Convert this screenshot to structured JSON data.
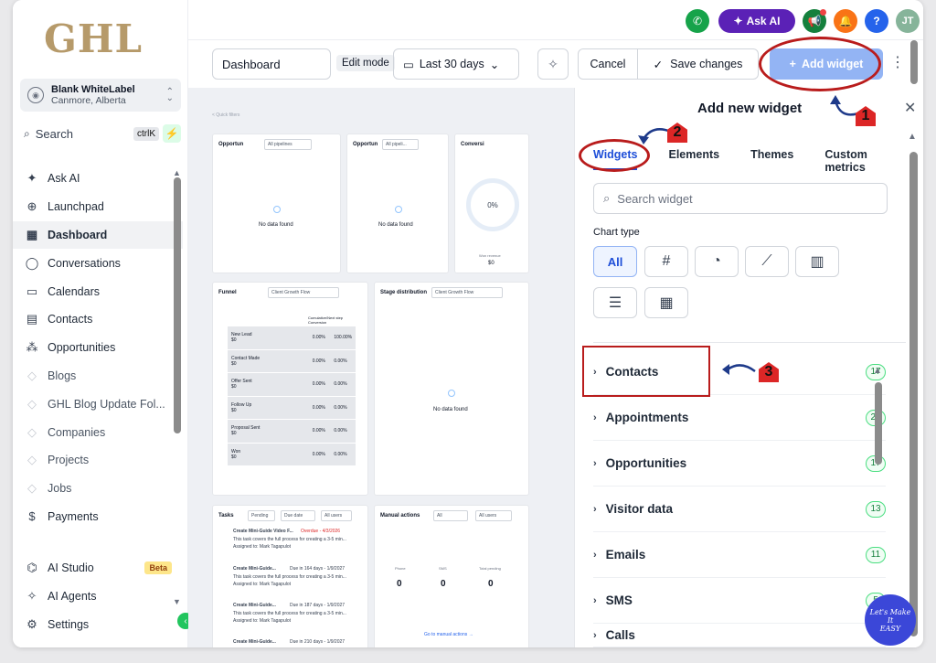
{
  "brand": {
    "logo": "GHL"
  },
  "account": {
    "name": "Blank WhiteLabel",
    "location": "Canmore, Alberta"
  },
  "search": {
    "label": "Search",
    "shortcut": "ctrlK"
  },
  "sidebar": {
    "items": [
      {
        "label": "Ask AI",
        "icon": "sparkle-icon"
      },
      {
        "label": "Launchpad",
        "icon": "rocket-icon"
      },
      {
        "label": "Dashboard",
        "icon": "grid-icon",
        "active": true
      },
      {
        "label": "Conversations",
        "icon": "chat-icon"
      },
      {
        "label": "Calendars",
        "icon": "calendar-icon"
      },
      {
        "label": "Contacts",
        "icon": "contacts-icon"
      },
      {
        "label": "Opportunities",
        "icon": "opportunities-icon"
      },
      {
        "label": "Blogs",
        "icon": "cube-icon",
        "muted": true
      },
      {
        "label": "GHL Blog Update Fol...",
        "icon": "cube-icon",
        "muted": true
      },
      {
        "label": "Companies",
        "icon": "cube-icon",
        "muted": true
      },
      {
        "label": "Projects",
        "icon": "cube-icon",
        "muted": true
      },
      {
        "label": "Jobs",
        "icon": "cube-icon",
        "muted": true
      },
      {
        "label": "Payments",
        "icon": "dollar-icon"
      }
    ],
    "bottom": [
      {
        "label": "AI Studio",
        "badge": "Beta"
      },
      {
        "label": "AI Agents"
      },
      {
        "label": "Settings"
      }
    ]
  },
  "topbar": {
    "ask_ai": "Ask AI",
    "user_initials": "JT",
    "help": "?"
  },
  "toolbar": {
    "dashboard_name": "Dashboard",
    "edit_mode": "Edit mode",
    "date_range": "Last 30 days",
    "cancel": "Cancel",
    "save": "Save changes",
    "add_widget": "Add widget"
  },
  "canvas": {
    "quick_filters": "< Quick filters",
    "cards": {
      "opp1_title": "Opportun",
      "opp1_select": "All pipelines",
      "opp2_title": "Opportun",
      "opp2_select": "All pipeli...",
      "conv_title": "Conversi",
      "no_data": "No data found",
      "ring_value": "0%",
      "won_revenue": "Won revenue",
      "won_value": "$0",
      "funnel_title": "Funnel",
      "funnel_select": "Client Growth Flow",
      "funnel_header": "Cumulative/Next step Conversion",
      "funnel_rows": [
        {
          "stage": "New Lead",
          "amount": "$0",
          "a": "0.00%",
          "b": "100.00%"
        },
        {
          "stage": "Contact Made",
          "amount": "$0",
          "a": "0.00%",
          "b": "0.00%"
        },
        {
          "stage": "Offer Sent",
          "amount": "$0",
          "a": "0.00%",
          "b": "0.00%"
        },
        {
          "stage": "Follow Up",
          "amount": "$0",
          "a": "0.00%",
          "b": "0.00%"
        },
        {
          "stage": "Proposal Sent",
          "amount": "$0",
          "a": "0.00%",
          "b": "0.00%"
        },
        {
          "stage": "Won",
          "amount": "$0",
          "a": "0.00%",
          "b": "0.00%"
        }
      ],
      "stage_title": "Stage distribution",
      "stage_select": "Client Growth Flow",
      "tasks_title": "Tasks",
      "tasks_pending": "Pending",
      "tasks_due": "Due date",
      "tasks_users": "All users",
      "task_items": [
        {
          "title": "Create Mini-Guide Video F...",
          "due": "Overdue - 4/3/2026",
          "desc": "This task covers the full process for creating a 3-5 min...",
          "assigned": "Assigned to: Mark Tagapulot"
        },
        {
          "title": "Create Mini-Guide...",
          "due": "Due in 164 days - 1/9/2027",
          "desc": "This task covers the full process for creating a 3-5 min...",
          "assigned": "Assigned to: Mark Tagapulot"
        },
        {
          "title": "Create Mini-Guide...",
          "due": "Due in 187 days - 1/9/2027",
          "desc": "This task covers the full process for creating a 3-5 min...",
          "assigned": "Assigned to: Mark Tagapulot"
        },
        {
          "title": "Create Mini-Guide...",
          "due": "Due in 210 days - 1/9/2027",
          "desc": "",
          "assigned": ""
        }
      ],
      "manual_title": "Manual actions",
      "manual_all": "All",
      "manual_users": "All users",
      "manual_cols": [
        "Phone",
        "SMS",
        "Total pending"
      ],
      "manual_vals": [
        "0",
        "0",
        "0"
      ],
      "manual_link": "Go to manual actions →"
    }
  },
  "panel": {
    "title": "Add new widget",
    "tabs": [
      "Widgets",
      "Elements",
      "Themes",
      "Custom metrics"
    ],
    "search_placeholder": "Search widget",
    "chart_type_label": "Chart type",
    "chart_types": [
      {
        "label": "All",
        "icon": "all"
      },
      {
        "label": "#",
        "icon": "number-icon"
      },
      {
        "label": "◔",
        "icon": "pie-chart-icon"
      },
      {
        "label": "⟋",
        "icon": "line-chart-icon"
      },
      {
        "label": "▥",
        "icon": "bar-chart-icon"
      },
      {
        "label": "☰",
        "icon": "horizontal-bar-icon"
      },
      {
        "label": "▦",
        "icon": "table-icon"
      }
    ],
    "categories": [
      {
        "label": "Contacts",
        "count": "17"
      },
      {
        "label": "Appointments",
        "count": "27"
      },
      {
        "label": "Opportunities",
        "count": "17"
      },
      {
        "label": "Visitor data",
        "count": "13"
      },
      {
        "label": "Emails",
        "count": "11"
      },
      {
        "label": "SMS",
        "count": "5"
      },
      {
        "label": "Calls",
        "count": ""
      }
    ]
  },
  "annotations": {
    "step1": "1",
    "step2": "2",
    "step3": "3"
  },
  "watermark": {
    "line1": "Let's Make",
    "line2": "It",
    "line3": "EASY"
  }
}
